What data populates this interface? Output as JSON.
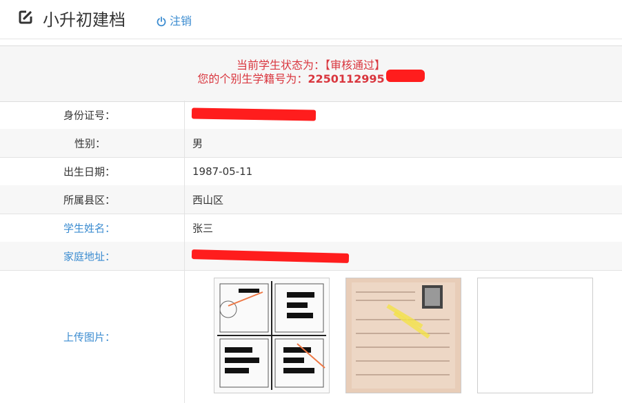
{
  "header": {
    "title": "小升初建档",
    "logout_label": "注销"
  },
  "status": {
    "line1": "当前学生状态为：【审核通过】",
    "line2_prefix": "您的个别生学籍号为：",
    "line2_number": "2250112995"
  },
  "fields": [
    {
      "label": "身份证号：",
      "value": ""
    },
    {
      "label": "性别：",
      "value": "男"
    },
    {
      "label": "出生日期：",
      "value": "1987-05-11"
    },
    {
      "label": "所属县区：",
      "value": "西山区"
    },
    {
      "label": "学生姓名：",
      "value": "张三"
    },
    {
      "label": "家庭地址：",
      "value": ""
    },
    {
      "label": "上传图片："
    }
  ],
  "colors": {
    "accent": "#3a8bd0",
    "alert": "#d9363e",
    "redaction": "#ff1d1d"
  },
  "photos": [
    "id-document-photo",
    "form-document-photo",
    "empty-photo-slot"
  ]
}
